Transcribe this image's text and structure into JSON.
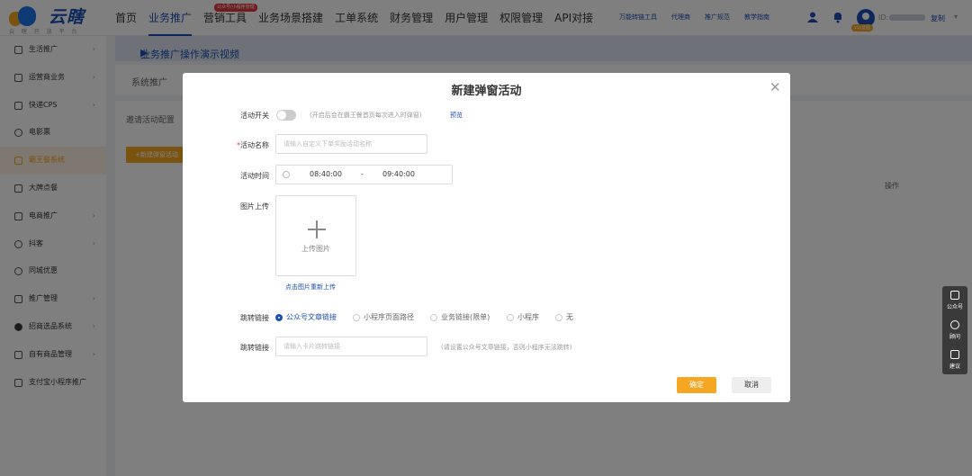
{
  "brand": {
    "name": "云瞎",
    "subtitle": "云 瞎 开 放 平 台"
  },
  "nav": {
    "items": [
      {
        "label": "首页",
        "active": false,
        "badge": ""
      },
      {
        "label": "业务推广",
        "active": true,
        "badge": ""
      },
      {
        "label": "营销工具",
        "active": false,
        "badge": "公众号/小程序管理"
      },
      {
        "label": "业务场景搭建",
        "active": false,
        "badge": ""
      },
      {
        "label": "工单系统",
        "active": false,
        "badge": ""
      },
      {
        "label": "财务管理",
        "active": false,
        "badge": ""
      },
      {
        "label": "用户管理",
        "active": false,
        "badge": ""
      },
      {
        "label": "权限管理",
        "active": false,
        "badge": ""
      },
      {
        "label": "API对接",
        "active": false,
        "badge": ""
      }
    ],
    "right_links": [
      "万能转链工具",
      "代理商",
      "推广规范",
      "教学指南"
    ],
    "user_id_label": "ID:",
    "copy_label": "复制",
    "vip_badge": "v认证图"
  },
  "sidebar": {
    "items": [
      {
        "label": "生活推广",
        "active": false,
        "has_chevron": true
      },
      {
        "label": "运营商业务",
        "active": false,
        "has_chevron": true
      },
      {
        "label": "快递CPS",
        "active": false,
        "has_chevron": true
      },
      {
        "label": "电影票",
        "active": false,
        "has_chevron": false
      },
      {
        "label": "霸王餐系统",
        "active": true,
        "has_chevron": false
      },
      {
        "label": "大牌点餐",
        "active": false,
        "has_chevron": false
      },
      {
        "label": "电商推广",
        "active": false,
        "has_chevron": true
      },
      {
        "label": "抖客",
        "active": false,
        "has_chevron": true
      },
      {
        "label": "同城优惠",
        "active": false,
        "has_chevron": false
      },
      {
        "label": "推广管理",
        "active": false,
        "has_chevron": true
      },
      {
        "label": "招商选品系统",
        "active": false,
        "has_chevron": true
      },
      {
        "label": "自有商品管理",
        "active": false,
        "has_chevron": true
      },
      {
        "label": "支付宝小程序推广",
        "active": false,
        "has_chevron": false
      }
    ]
  },
  "background": {
    "page_title": "业务推广操作演示视频",
    "tab": "系统推广",
    "section": "邀请活动配置",
    "new_button": "+新建弹窗活动",
    "col_action": "操作"
  },
  "modal": {
    "title": "新建弹窗活动",
    "close_icon": "close-icon",
    "switch": {
      "label": "活动开关",
      "hint": "(开启后会在霸王餐首页每次进入时弹窗)",
      "preview": "预览",
      "on": false
    },
    "name": {
      "label": "活动名称",
      "required": true,
      "placeholder": "请输入自定义下单奖励活动名称"
    },
    "time": {
      "label": "活动时间",
      "start": "08:40:00",
      "separator": "-",
      "end": "09:40:00"
    },
    "image": {
      "label": "图片上传",
      "upload_text": "上传图片",
      "reupload": "点击图片重新上传"
    },
    "jump": {
      "label": "跳转链接",
      "options": [
        {
          "label": "公众号文章链接",
          "checked": true
        },
        {
          "label": "小程序页面路径",
          "checked": false
        },
        {
          "label": "业务链接(限单)",
          "checked": false
        },
        {
          "label": "小程序",
          "checked": false
        },
        {
          "label": "无",
          "checked": false
        }
      ]
    },
    "jump_link": {
      "label": "跳转链接",
      "placeholder": "请输入卡片跳转链接",
      "hint": "(请设置公众号文章链接，否则小程序无法跳转)"
    },
    "ok": "确定",
    "cancel": "取消"
  },
  "float_tools": [
    {
      "label": "公众号",
      "icon": "chat-icon"
    },
    {
      "label": "顾问",
      "icon": "headset-icon"
    },
    {
      "label": "建议",
      "icon": "edit-icon"
    }
  ],
  "colors": {
    "primary": "#1a4fb5",
    "accent": "#f5a623",
    "danger": "#e0393e"
  }
}
